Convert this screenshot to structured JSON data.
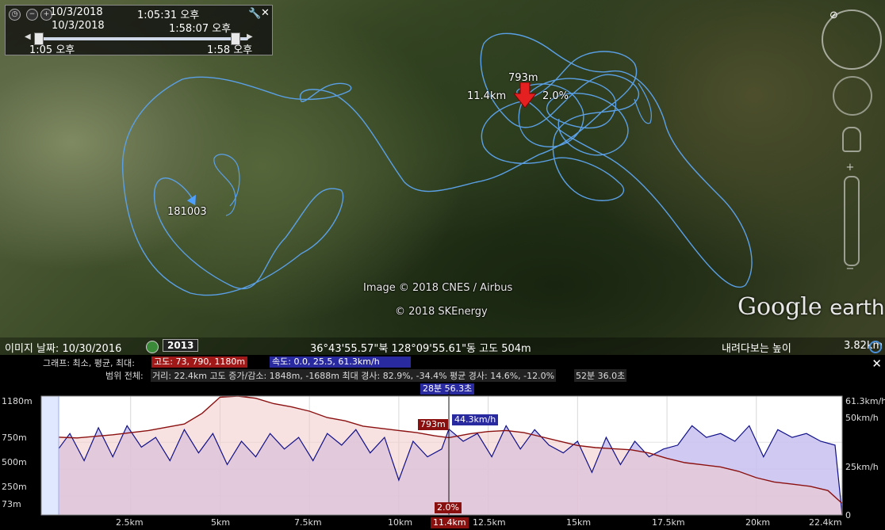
{
  "timebar": {
    "date_start": "10/3/2018",
    "time_start": "1:05:31 오후",
    "date_end": "10/3/2018",
    "time_end": "1:58:07 오후",
    "range_start": "1:05 오후",
    "range_end": "1:58 오후"
  },
  "map": {
    "marker_label": "181003",
    "current_altitude": "793m",
    "current_distance": "11.4km",
    "current_grade": "2.0%",
    "credit_1": "Image © 2018 CNES / Airbus",
    "credit_2": "© 2018 SKEnergy",
    "logo_main": "Google",
    "logo_sub": "earth",
    "track_color": "#5aa0e6",
    "marker_color": "#e52020"
  },
  "statusbar": {
    "imagery_date_label": "이미지 날짜: 10/30/2016",
    "year_badge": "2013",
    "coordinates": "36°43'55.57\"북 128°09'55.61\"동 고도   504m",
    "eye_alt_label": "내려다보는 높이",
    "eye_alt_value": "3.82km"
  },
  "profile": {
    "graph_label": "그래프: 최소, 평균, 최대:",
    "altitude_pill": "고도: 73, 790, 1180m",
    "speed_pill": "속도: 0.0, 25.5, 61.3km/h",
    "range_label": "범위 전체:",
    "range_stats": "거리: 22.4km 고도 증가/감소: 1848m, -1688m  최대 경사: 82.9%, -34.4%  평균 경사: 14.6%, -12.0%",
    "duration_stats": "52분 36.0초",
    "cursor_time": "28분 56.3초",
    "cursor_altitude": "793m",
    "cursor_speed": "44.3km/h",
    "cursor_grade": "2.0%",
    "cursor_distance": "11.4km",
    "close_icon": "close-icon",
    "y_left_ticks": [
      "1180m",
      "750m",
      "500m",
      "250m",
      "73m"
    ],
    "y_right_ticks": [
      "61.3km/h",
      "50km/h",
      "25km/h",
      "0"
    ],
    "x_ticks": [
      "2.5km",
      "5km",
      "7.5km",
      "10km",
      "12.5km",
      "15km",
      "17.5km",
      "20km",
      "22.4km"
    ]
  },
  "chart_data": {
    "type": "area",
    "xlabel": "",
    "ylabel": "",
    "x_unit": "km",
    "xlim": [
      0,
      22.4
    ],
    "ylim_left": [
      73,
      1180
    ],
    "ylim_right": [
      0,
      61.3
    ],
    "series": [
      {
        "name": "고도",
        "axis": "left",
        "color": "#8b1010",
        "fill": "#f0c8c8",
        "x": [
          0,
          0.3,
          1,
          2,
          3,
          4,
          4.5,
          5,
          5.5,
          6,
          6.5,
          7,
          7.5,
          8,
          8.5,
          9,
          9.5,
          10,
          10.5,
          11,
          11.4,
          12,
          12.5,
          13,
          13.5,
          14,
          14.5,
          15,
          15.5,
          16,
          16.5,
          17,
          17.5,
          18,
          18.5,
          19,
          19.5,
          20,
          20.5,
          21,
          21.5,
          22,
          22.4
        ],
        "values": [
          73,
          800,
          790,
          820,
          860,
          920,
          1020,
          1170,
          1180,
          1160,
          1110,
          1080,
          1040,
          980,
          950,
          900,
          880,
          860,
          840,
          810,
          793,
          830,
          850,
          860,
          840,
          800,
          760,
          720,
          700,
          690,
          680,
          650,
          600,
          560,
          540,
          520,
          480,
          420,
          380,
          360,
          340,
          300,
          180
        ]
      },
      {
        "name": "속도",
        "axis": "right",
        "color": "#10108a",
        "fill": "#c8c0f0",
        "x": [
          0,
          0.2,
          0.4,
          0.8,
          1.2,
          1.6,
          2.0,
          2.4,
          2.8,
          3.2,
          3.6,
          4.0,
          4.4,
          4.8,
          5.2,
          5.6,
          6.0,
          6.4,
          6.8,
          7.2,
          7.6,
          8.0,
          8.4,
          8.8,
          9.2,
          9.6,
          10.0,
          10.4,
          10.8,
          11.2,
          11.4,
          11.8,
          12.2,
          12.6,
          13.0,
          13.4,
          13.8,
          14.2,
          14.6,
          15.0,
          15.4,
          15.8,
          16.2,
          16.6,
          17.0,
          17.4,
          17.8,
          18.2,
          18.6,
          19.0,
          19.4,
          19.8,
          20.2,
          20.6,
          21.0,
          21.4,
          21.8,
          22.2,
          22.4
        ],
        "values": [
          0,
          0,
          32,
          42,
          28,
          45,
          30,
          46,
          35,
          40,
          28,
          44,
          32,
          42,
          26,
          38,
          30,
          42,
          34,
          40,
          28,
          42,
          36,
          44,
          32,
          40,
          18,
          38,
          30,
          34,
          44.3,
          38,
          42,
          30,
          46,
          34,
          44,
          36,
          32,
          38,
          22,
          40,
          26,
          38,
          30,
          34,
          36,
          46,
          40,
          42,
          38,
          46,
          30,
          44,
          40,
          42,
          38,
          36,
          0
        ]
      }
    ],
    "cursor_x": 11.4
  }
}
